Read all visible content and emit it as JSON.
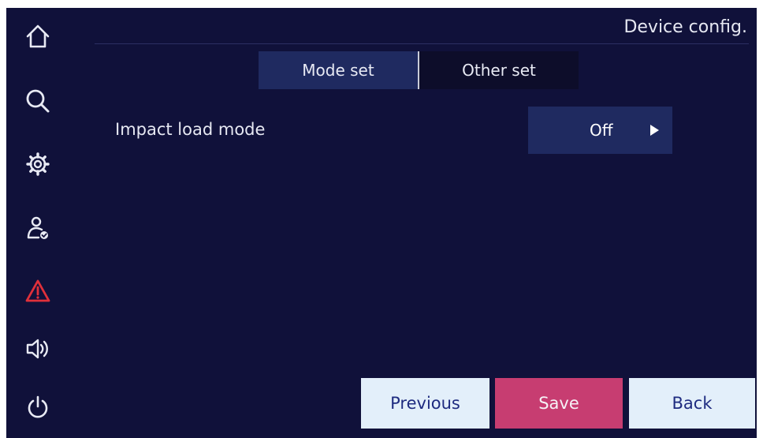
{
  "window": {
    "title": "Device config."
  },
  "sidebar": {
    "items": [
      {
        "icon": "home-icon"
      },
      {
        "icon": "search-icon"
      },
      {
        "icon": "gear-icon"
      },
      {
        "icon": "user-check-icon"
      },
      {
        "icon": "warning-icon",
        "color": "#e0303a"
      },
      {
        "icon": "speaker-icon"
      },
      {
        "icon": "power-icon"
      }
    ],
    "icon_color": "#e8eaf4"
  },
  "tabs": [
    {
      "label": "Mode set",
      "active": true
    },
    {
      "label": "Other set",
      "active": false
    }
  ],
  "settings": [
    {
      "label": "Impact load mode",
      "value": "Off"
    }
  ],
  "buttons": {
    "previous": "Previous",
    "save": "Save",
    "back": "Back"
  },
  "colors": {
    "background": "#10113a",
    "active_tab": "#1f2a60",
    "save_button": "#c73d71",
    "light_button": "#e3effa",
    "alert": "#e0303a"
  }
}
